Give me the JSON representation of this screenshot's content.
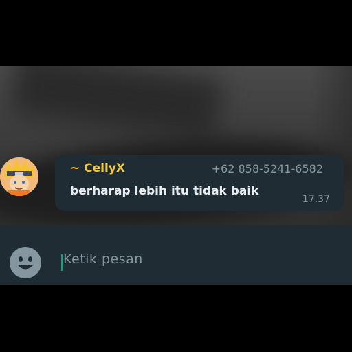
{
  "message": {
    "sender": "~ CellyX",
    "phone": "+62 858-5241-6582",
    "text": "berharap lebih itu tidak baik",
    "time": "17.37"
  },
  "composer": {
    "placeholder": "Ketik pesan",
    "emoji_icon": "emoji-icon",
    "caret_color": "#00a884"
  },
  "colors": {
    "bubble_bg": "#1f2c34",
    "sender_color": "#f5c842",
    "meta_color": "#8696a0",
    "text_color": "#e9edef"
  }
}
